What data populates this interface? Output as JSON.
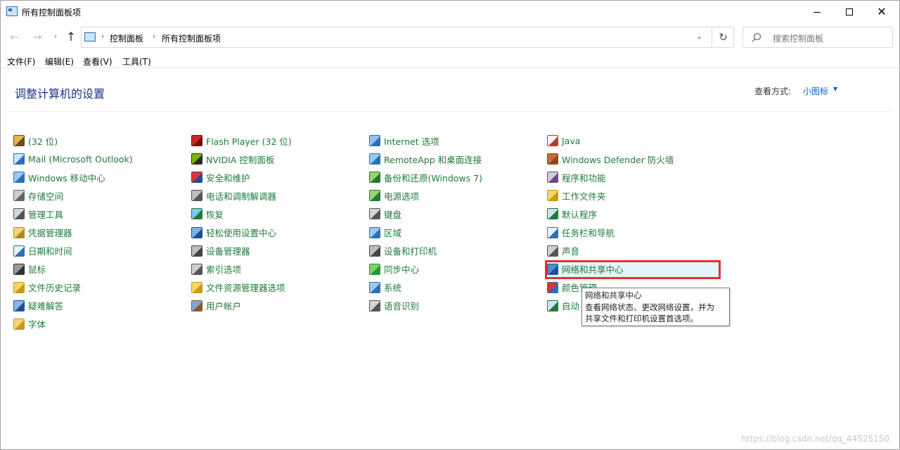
{
  "window": {
    "title": "所有控制面板项"
  },
  "address": {
    "crumbs": [
      "控制面板",
      "所有控制面板项"
    ],
    "search_placeholder": "搜索控制面板"
  },
  "menu": [
    "文件(F)",
    "编辑(E)",
    "查看(V)",
    "工具(T)"
  ],
  "content": {
    "heading": "调整计算机的设置",
    "view_by_label": "查看方式:",
    "view_by_value": "小图标"
  },
  "columns": [
    [
      {
        "label": "(32 位)",
        "icon": "flash-settings-icon"
      },
      {
        "label": "Mail (Microsoft Outlook)",
        "icon": "mail-icon"
      },
      {
        "label": "Windows 移动中心",
        "icon": "mobility-center-icon"
      },
      {
        "label": "存储空间",
        "icon": "storage-spaces-icon"
      },
      {
        "label": "管理工具",
        "icon": "admin-tools-icon"
      },
      {
        "label": "凭据管理器",
        "icon": "credential-manager-icon"
      },
      {
        "label": "日期和时间",
        "icon": "date-time-icon"
      },
      {
        "label": "鼠标",
        "icon": "mouse-icon"
      },
      {
        "label": "文件历史记录",
        "icon": "file-history-icon"
      },
      {
        "label": "疑难解答",
        "icon": "troubleshooting-icon"
      },
      {
        "label": "字体",
        "icon": "fonts-icon"
      }
    ],
    [
      {
        "label": "Flash Player (32 位)",
        "icon": "flash-player-icon"
      },
      {
        "label": "NVIDIA 控制面板",
        "icon": "nvidia-icon"
      },
      {
        "label": "安全和维护",
        "icon": "security-flag-icon"
      },
      {
        "label": "电话和调制解调器",
        "icon": "phone-modem-icon"
      },
      {
        "label": "恢复",
        "icon": "recovery-icon"
      },
      {
        "label": "轻松使用设置中心",
        "icon": "ease-of-access-icon"
      },
      {
        "label": "设备管理器",
        "icon": "device-manager-icon"
      },
      {
        "label": "索引选项",
        "icon": "indexing-icon"
      },
      {
        "label": "文件资源管理器选项",
        "icon": "folder-options-icon"
      },
      {
        "label": "用户帐户",
        "icon": "user-accounts-icon"
      }
    ],
    [
      {
        "label": "Internet 选项",
        "icon": "internet-options-icon"
      },
      {
        "label": "RemoteApp 和桌面连接",
        "icon": "remoteapp-icon"
      },
      {
        "label": "备份和还原(Windows 7)",
        "icon": "backup-icon"
      },
      {
        "label": "电源选项",
        "icon": "power-icon"
      },
      {
        "label": "键盘",
        "icon": "keyboard-icon"
      },
      {
        "label": "区域",
        "icon": "region-icon"
      },
      {
        "label": "设备和打印机",
        "icon": "printer-icon"
      },
      {
        "label": "同步中心",
        "icon": "sync-icon"
      },
      {
        "label": "系统",
        "icon": "system-icon"
      },
      {
        "label": "语音识别",
        "icon": "microphone-icon"
      }
    ],
    [
      {
        "label": "Java",
        "icon": "java-icon"
      },
      {
        "label": "Windows Defender 防火墙",
        "icon": "firewall-icon"
      },
      {
        "label": "程序和功能",
        "icon": "programs-icon"
      },
      {
        "label": "工作文件夹",
        "icon": "work-folders-icon"
      },
      {
        "label": "默认程序",
        "icon": "default-programs-icon"
      },
      {
        "label": "任务栏和导航",
        "icon": "taskbar-icon"
      },
      {
        "label": "声音",
        "icon": "sound-icon"
      },
      {
        "label": "网络和共享中心",
        "icon": "network-icon"
      },
      {
        "label": "颜色管理",
        "icon": "color-management-icon"
      },
      {
        "label": "自动",
        "icon": "autoplay-icon"
      }
    ]
  ],
  "tooltip": {
    "lines": [
      "网络和共享中心",
      "查看网络状态、更改网络设置，并为",
      "共享文件和打印机设置首选项。"
    ]
  },
  "watermark": "https://blog.csdn.net/qq_44525150",
  "colors": {
    "link_green": "#1f7a3a",
    "heading_blue": "#1e3287",
    "highlight_red": "#e5312f",
    "hover_bg": "#e5f3fb"
  }
}
